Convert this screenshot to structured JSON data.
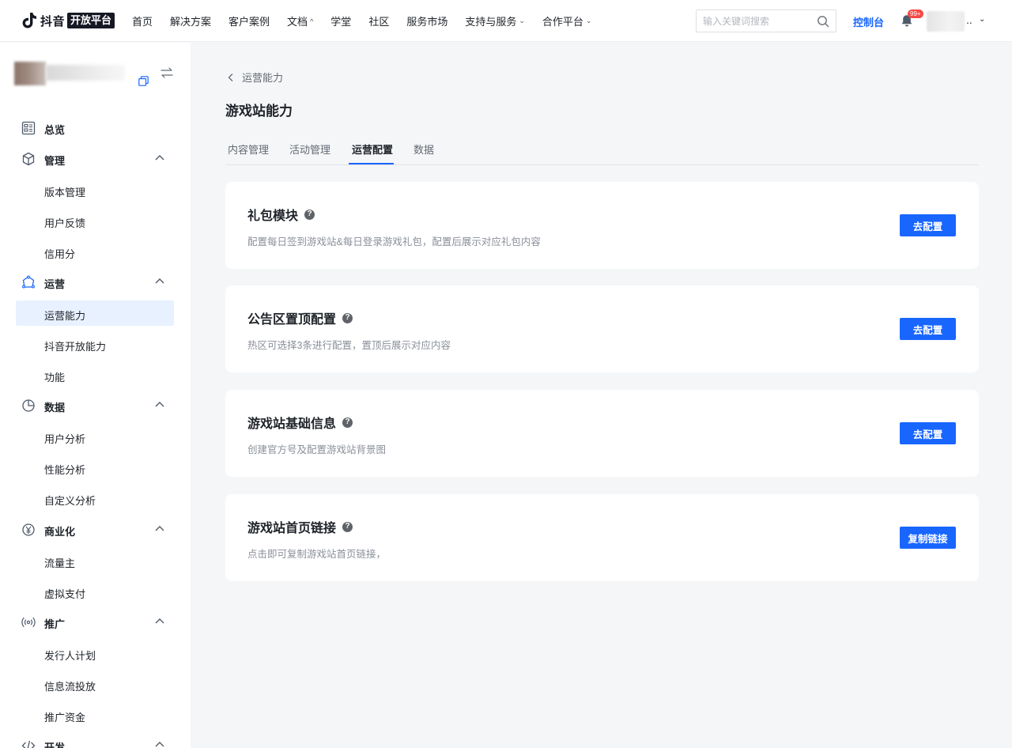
{
  "header": {
    "logo_text": "抖音",
    "logo_badge": "开放平台",
    "nav": [
      {
        "label": "首页",
        "has_dropdown": false
      },
      {
        "label": "解决方案",
        "has_dropdown": false
      },
      {
        "label": "客户案例",
        "has_dropdown": false
      },
      {
        "label": "文档",
        "has_dropdown": true,
        "expanded": true
      },
      {
        "label": "学堂",
        "has_dropdown": false
      },
      {
        "label": "社区",
        "has_dropdown": false
      },
      {
        "label": "服务市场",
        "has_dropdown": false
      },
      {
        "label": "支持与服务",
        "has_dropdown": true,
        "expanded": false
      },
      {
        "label": "合作平台",
        "has_dropdown": true,
        "expanded": false
      }
    ],
    "search_placeholder": "输入关键词搜索",
    "console_label": "控制台",
    "notification_badge": "99+",
    "user_name_suffix": ".."
  },
  "sidebar": {
    "groups": [
      {
        "label": "总览",
        "icon": "dashboard-icon",
        "collapsible": false
      },
      {
        "label": "管理",
        "icon": "box-icon",
        "collapsible": true,
        "items": [
          "版本管理",
          "用户反馈",
          "信用分"
        ]
      },
      {
        "label": "运营",
        "icon": "operation-icon",
        "collapsible": true,
        "items": [
          "运营能力",
          "抖音开放能力",
          "功能"
        ],
        "active_item": "运营能力"
      },
      {
        "label": "数据",
        "icon": "pie-chart-icon",
        "collapsible": true,
        "items": [
          "用户分析",
          "性能分析",
          "自定义分析"
        ]
      },
      {
        "label": "商业化",
        "icon": "yen-icon",
        "collapsible": true,
        "items": [
          "流量主",
          "虚拟支付"
        ]
      },
      {
        "label": "推广",
        "icon": "broadcast-icon",
        "collapsible": true,
        "items": [
          "发行人计划",
          "信息流投放",
          "推广资金"
        ]
      },
      {
        "label": "开发",
        "icon": "code-icon",
        "collapsible": true
      }
    ]
  },
  "main": {
    "breadcrumb": "运营能力",
    "page_title": "游戏站能力",
    "tabs": [
      {
        "label": "内容管理"
      },
      {
        "label": "活动管理"
      },
      {
        "label": "运营配置",
        "active": true
      },
      {
        "label": "数据"
      }
    ],
    "cards": [
      {
        "title": "礼包模块",
        "desc": "配置每日签到游戏站&每日登录游戏礼包，配置后展示对应礼包内容",
        "button": "去配置"
      },
      {
        "title": "公告区置顶配置",
        "desc": "热区可选择3条进行配置，置顶后展示对应内容",
        "button": "去配置"
      },
      {
        "title": "游戏站基础信息",
        "desc": "创建官方号及配置游戏站背景图",
        "button": "去配置"
      },
      {
        "title": "游戏站首页链接",
        "desc": "点击即可复制游戏站首页链接，",
        "button": "复制链接"
      }
    ]
  },
  "colors": {
    "accent": "#1966ff",
    "active_bg": "#e8f1ff",
    "page_bg": "#f5f6f8",
    "badge": "#f54a45"
  }
}
